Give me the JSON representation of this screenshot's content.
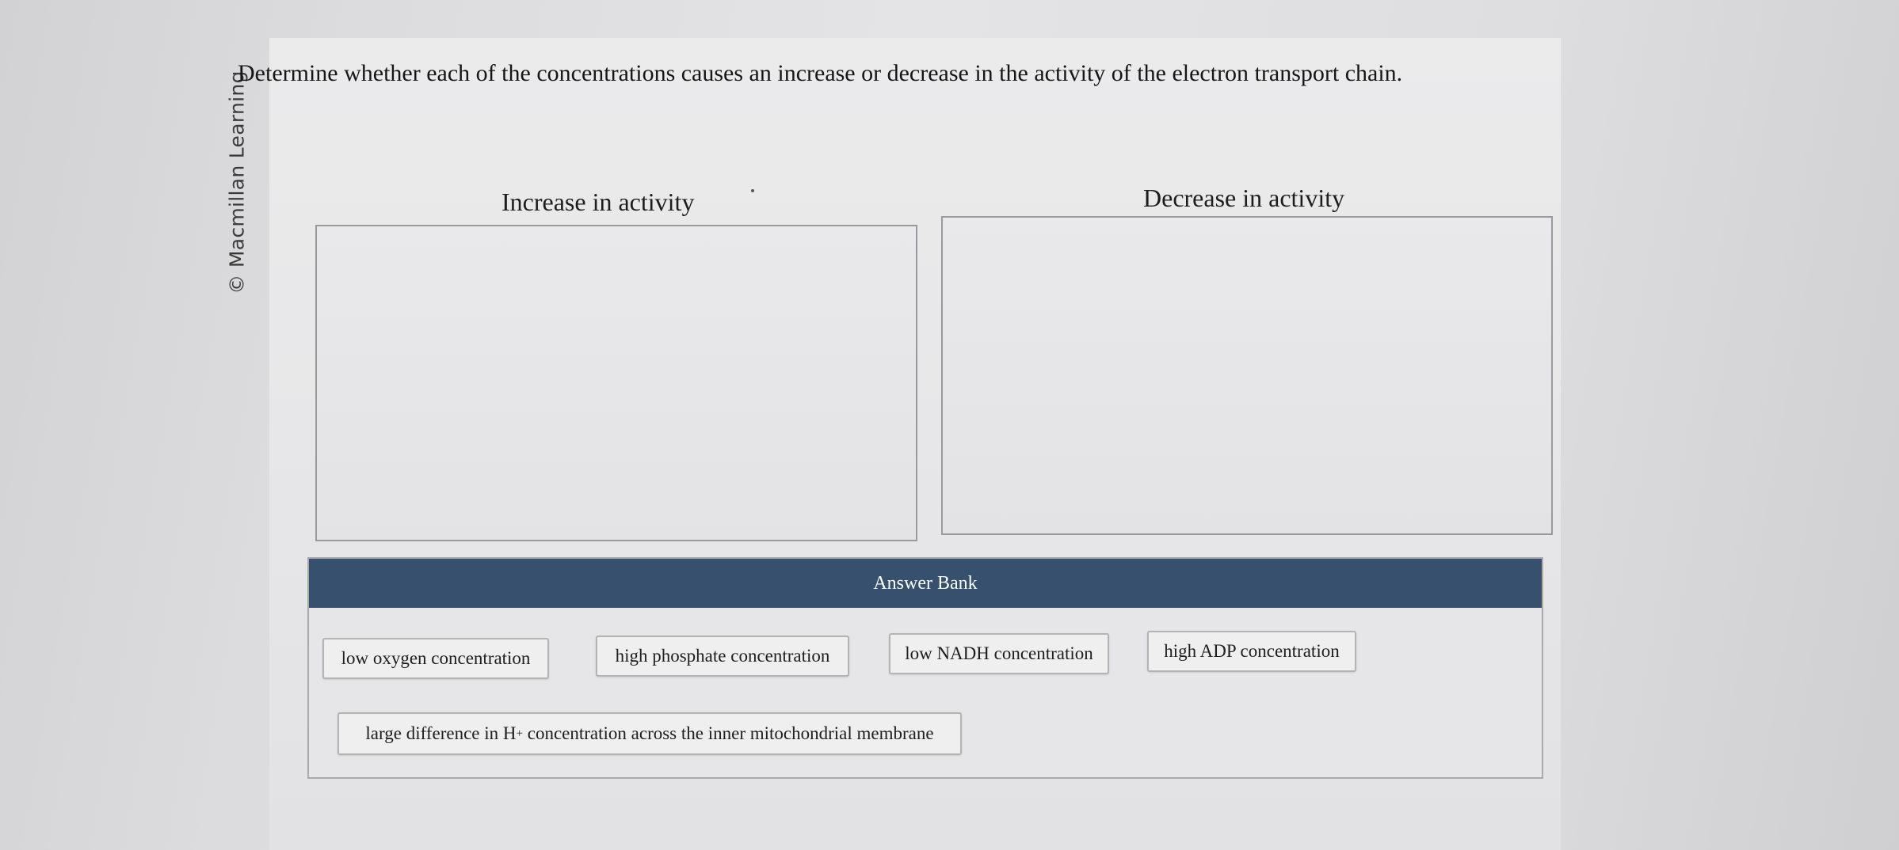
{
  "watermark": "© Macmillan Learning",
  "question": {
    "prompt": "Determine whether each of the concentrations causes an increase or decrease in the activity of the electron transport chain."
  },
  "categories": {
    "increase": "Increase in activity",
    "decrease": "Decrease in activity"
  },
  "answer_bank": {
    "title": "Answer Bank",
    "items": [
      "low oxygen concentration",
      "high phosphate concentration",
      "low NADH concentration",
      "high ADP concentration"
    ],
    "item_h_gradient": {
      "before": "large difference in H",
      "sup": "+",
      "after": " concentration across the inner mitochondrial membrane"
    }
  }
}
